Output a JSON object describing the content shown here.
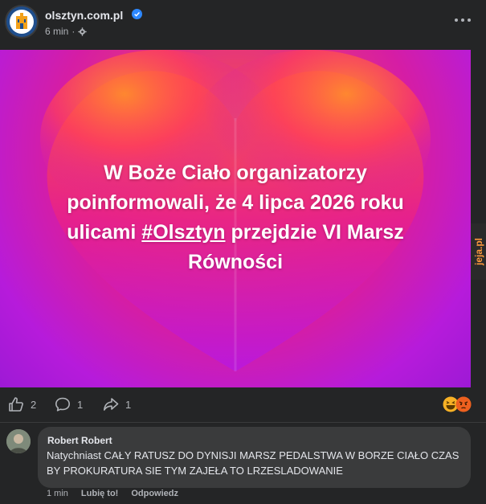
{
  "post": {
    "page_name": "olsztyn.com.pl",
    "time": "6 min",
    "separator": "·",
    "privacy_icon": "gear-icon",
    "image_text": {
      "line1": "W Boże Ciało organizatorzy",
      "line2": "poinformowali, że 4 lipca 2026 roku",
      "line3_prefix": "ulicami ",
      "hashtag": "#Olsztyn",
      "line3_suffix": " przejdzie VI Marsz",
      "line4": "Równości"
    },
    "watermark": {
      "main": "jeja",
      "suffix": ".pl"
    }
  },
  "actions": {
    "likes": "2",
    "comments": "1",
    "shares": "1"
  },
  "comment": {
    "author": "Robert Robert",
    "text": "Natychniast CAŁY RATUSZ DO DYNISJI MARSZ PEDALSTWA W BORZE CIAŁO CZAS BY PROKURATURA SIE TYM ZAJEŁA TO LRZESLADOWANIE",
    "time": "1 min",
    "like_label": "Lubię to!",
    "reply_label": "Odpowiedz"
  },
  "colors": {
    "background": "#242526",
    "bubble": "#3a3b3c",
    "verified": "#2d88ff"
  }
}
